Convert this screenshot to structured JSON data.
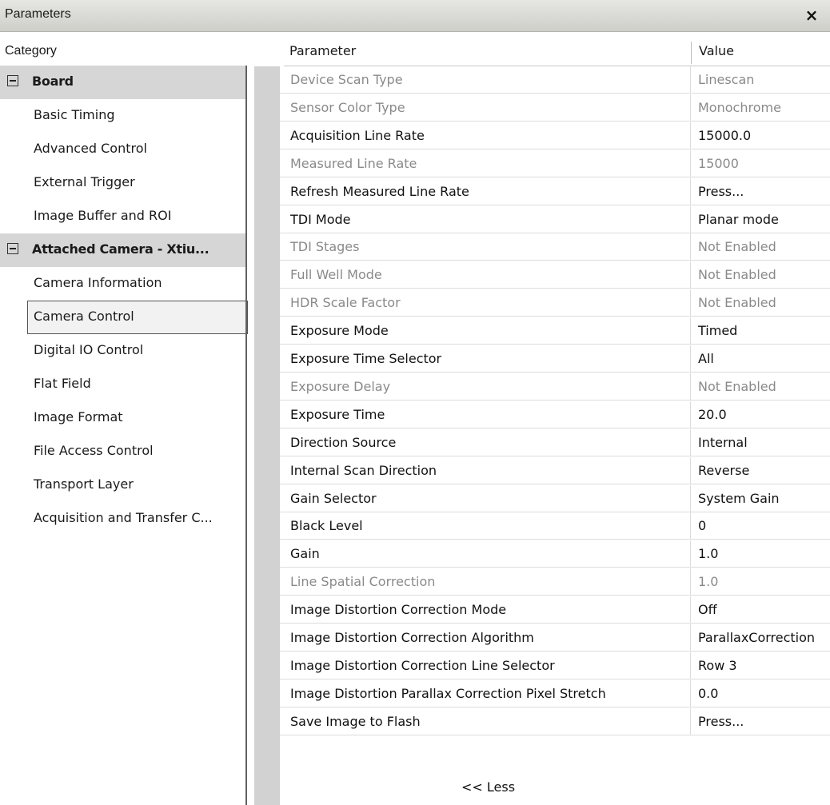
{
  "window": {
    "title": "Parameters",
    "close_glyph": "×"
  },
  "headers": {
    "category": "Category",
    "parameter": "Parameter",
    "value": "Value"
  },
  "categories": [
    {
      "label": "Board",
      "type": "group",
      "expanded": true
    },
    {
      "label": "Basic Timing",
      "type": "item"
    },
    {
      "label": "Advanced Control",
      "type": "item"
    },
    {
      "label": "External Trigger",
      "type": "item"
    },
    {
      "label": "Image Buffer and ROI",
      "type": "item"
    },
    {
      "label": "Attached Camera - Xtiu...",
      "type": "group",
      "expanded": true
    },
    {
      "label": "Camera Information",
      "type": "item"
    },
    {
      "label": "Camera Control",
      "type": "item",
      "selected": true
    },
    {
      "label": "Digital IO Control",
      "type": "item"
    },
    {
      "label": "Flat Field",
      "type": "item"
    },
    {
      "label": "Image Format",
      "type": "item"
    },
    {
      "label": "File Access Control",
      "type": "item"
    },
    {
      "label": "Transport Layer",
      "type": "item"
    },
    {
      "label": "Acquisition and Transfer C...",
      "type": "item"
    }
  ],
  "parameters": [
    {
      "name": "Device Scan Type",
      "value": "Linescan",
      "enabled": false
    },
    {
      "name": "Sensor Color Type",
      "value": "Monochrome",
      "enabled": false
    },
    {
      "name": "Acquisition Line Rate",
      "value": "15000.0",
      "enabled": true
    },
    {
      "name": "Measured Line Rate",
      "value": "15000",
      "enabled": false
    },
    {
      "name": "Refresh Measured Line Rate",
      "value": "Press...",
      "enabled": true
    },
    {
      "name": "TDI Mode",
      "value": "Planar mode",
      "enabled": true
    },
    {
      "name": "TDI Stages",
      "value": "Not Enabled",
      "enabled": false
    },
    {
      "name": "Full Well Mode",
      "value": "Not Enabled",
      "enabled": false
    },
    {
      "name": "HDR Scale Factor",
      "value": "Not Enabled",
      "enabled": false
    },
    {
      "name": "Exposure Mode",
      "value": "Timed",
      "enabled": true
    },
    {
      "name": "Exposure Time Selector",
      "value": "All",
      "enabled": true
    },
    {
      "name": "Exposure Delay",
      "value": "Not Enabled",
      "enabled": false
    },
    {
      "name": "Exposure Time",
      "value": "20.0",
      "enabled": true
    },
    {
      "name": "Direction Source",
      "value": "Internal",
      "enabled": true
    },
    {
      "name": "Internal Scan Direction",
      "value": "Reverse",
      "enabled": true
    },
    {
      "name": "Gain Selector",
      "value": "System Gain",
      "enabled": true
    },
    {
      "name": "Black Level",
      "value": "0",
      "enabled": true
    },
    {
      "name": "Gain",
      "value": "1.0",
      "enabled": true
    },
    {
      "name": "Line Spatial Correction",
      "value": "1.0",
      "enabled": false
    },
    {
      "name": "Image Distortion Correction Mode",
      "value": "Off",
      "enabled": true
    },
    {
      "name": "Image Distortion Correction Algorithm",
      "value": "ParallaxCorrection",
      "enabled": true
    },
    {
      "name": "Image Distortion Correction Line Selector",
      "value": "Row 3",
      "enabled": true
    },
    {
      "name": "Image Distortion Parallax Correction Pixel Stretch",
      "value": "0.0",
      "enabled": true
    },
    {
      "name": "Save Image to Flash",
      "value": "Press...",
      "enabled": true
    }
  ],
  "footer": {
    "less_label": "<< Less"
  },
  "colors": {
    "enabled_text": "#111111",
    "disabled_text": "#8a8a8a",
    "group_bg": "#d6d6d6",
    "gutter": "#d2d2d2"
  }
}
